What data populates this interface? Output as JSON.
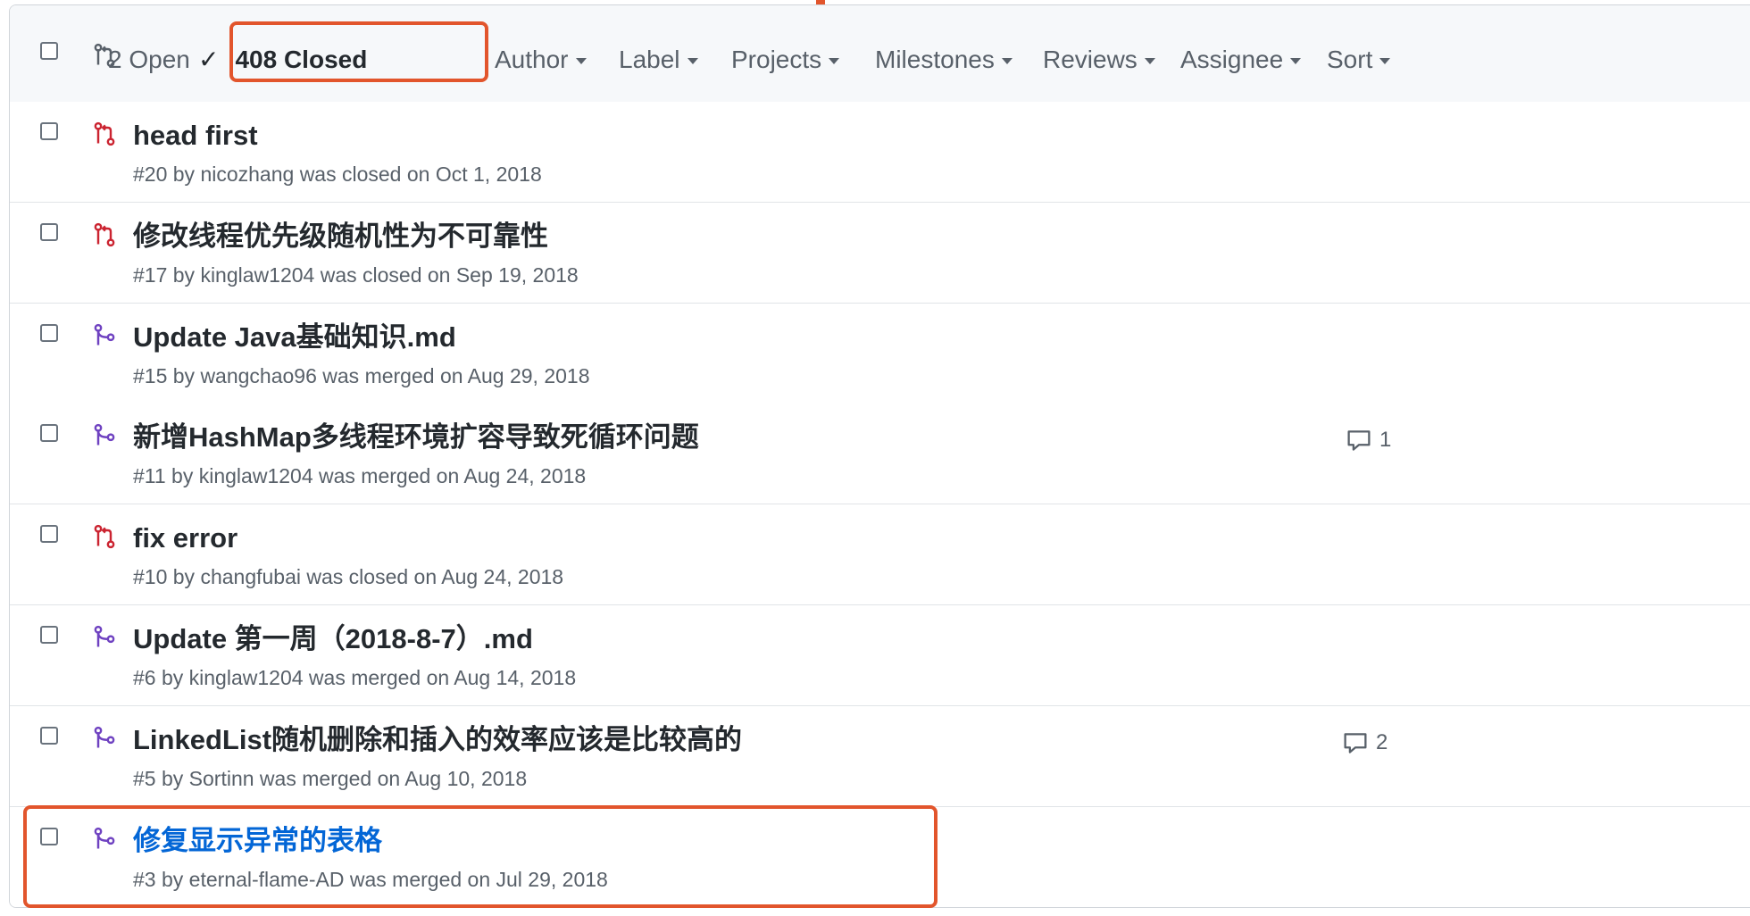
{
  "header": {
    "open_label": "2 Open",
    "closed_label": "408 Closed",
    "filters": [
      "Author",
      "Label",
      "Projects",
      "Milestones",
      "Reviews",
      "Assignee",
      "Sort"
    ]
  },
  "colors": {
    "closed": "#cb2431",
    "merged": "#6f42c1",
    "highlight": "#e2552c",
    "link": "#0366d6"
  },
  "pull_requests": [
    {
      "title": "head first",
      "meta": "#20 by nicozhang was closed on Oct 1, 2018",
      "state": "closed",
      "state_icon": "pr-closed-icon",
      "comments": ""
    },
    {
      "title": "修改线程优先级随机性为不可靠性",
      "meta": "#17 by kinglaw1204 was closed on Sep 19, 2018",
      "state": "closed",
      "state_icon": "pr-closed-icon",
      "comments": ""
    },
    {
      "title": "Update Java基础知识.md",
      "meta": "#15 by wangchao96 was merged on Aug 29, 2018",
      "state": "merged",
      "state_icon": "pr-merged-icon",
      "comments": ""
    },
    {
      "title": "新增HashMap多线程环境扩容导致死循环问题",
      "meta": "#11 by kinglaw1204 was merged on Aug 24, 2018",
      "state": "merged",
      "state_icon": "pr-merged-icon",
      "comments": "1"
    },
    {
      "title": "fix error",
      "meta": "#10 by changfubai was closed on Aug 24, 2018",
      "state": "closed",
      "state_icon": "pr-closed-icon",
      "comments": ""
    },
    {
      "title": "Update 第一周（2018-8-7）.md",
      "meta": "#6 by kinglaw1204 was merged on Aug 14, 2018",
      "state": "merged",
      "state_icon": "pr-merged-icon",
      "comments": ""
    },
    {
      "title": "LinkedList随机删除和插入的效率应该是比较高的",
      "meta": "#5 by Sortinn was merged on Aug 10, 2018",
      "state": "merged",
      "state_icon": "pr-merged-icon",
      "comments": "2"
    },
    {
      "title": "修复显示异常的表格",
      "meta": "#3 by eternal-flame-AD was merged on Jul 29, 2018",
      "state": "merged",
      "state_icon": "pr-merged-icon",
      "comments": ""
    }
  ]
}
